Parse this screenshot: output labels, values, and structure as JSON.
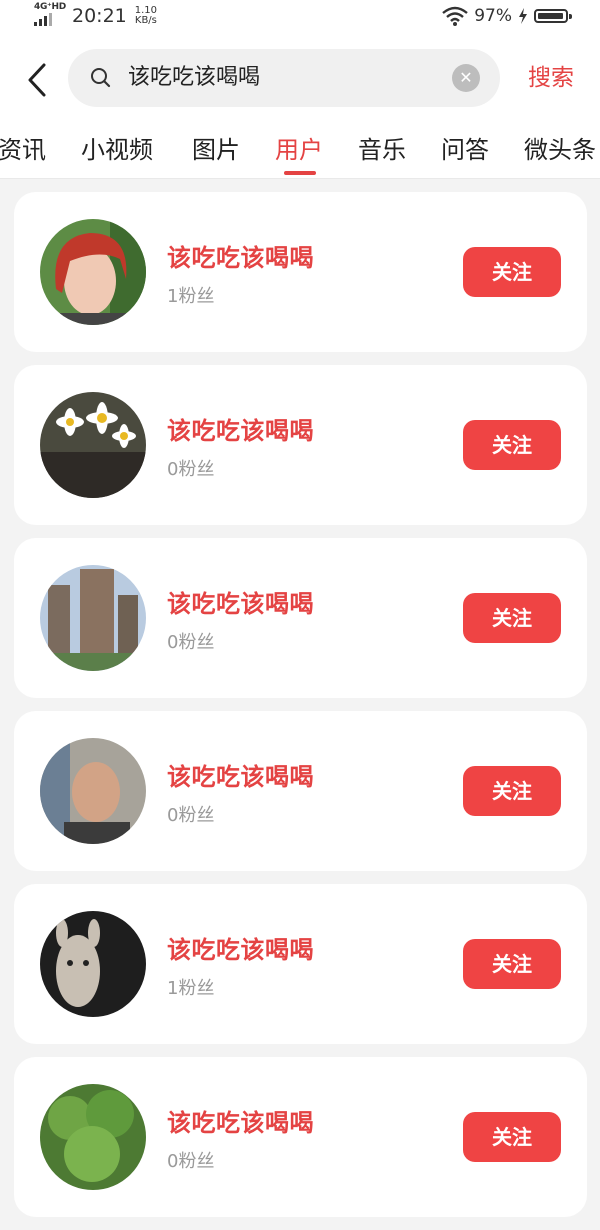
{
  "status_bar": {
    "network": "4G⁺HD",
    "time": "20:21",
    "speed_value": "1.10",
    "speed_unit": "KB/s",
    "battery": "97%",
    "battery_level": 0.97
  },
  "search": {
    "query": "该吃吃该喝喝",
    "clear_icon": "✕",
    "submit_label": "搜索"
  },
  "tabs": [
    {
      "label": "资讯"
    },
    {
      "label": "小视频"
    },
    {
      "label": "图片"
    },
    {
      "label": "用户",
      "active": true
    },
    {
      "label": "音乐"
    },
    {
      "label": "问答"
    },
    {
      "label": "微头条"
    }
  ],
  "users": [
    {
      "name": "该吃吃该喝喝",
      "fans": "1粉丝",
      "follow_label": "关注"
    },
    {
      "name": "该吃吃该喝喝",
      "fans": "0粉丝",
      "follow_label": "关注"
    },
    {
      "name": "该吃吃该喝喝",
      "fans": "0粉丝",
      "follow_label": "关注"
    },
    {
      "name": "该吃吃该喝喝",
      "fans": "0粉丝",
      "follow_label": "关注"
    },
    {
      "name": "该吃吃该喝喝",
      "fans": "1粉丝",
      "follow_label": "关注"
    },
    {
      "name": "该吃吃该喝喝",
      "fans": "0粉丝",
      "follow_label": "关注"
    }
  ],
  "colors": {
    "accent": "#e44343",
    "follow_button": "#ef4444",
    "background": "#f3f3f3"
  }
}
